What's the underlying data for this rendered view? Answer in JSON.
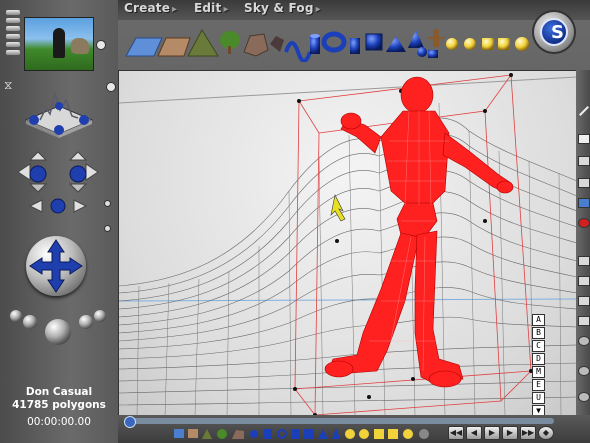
{
  "menu": {
    "items": [
      {
        "label": "Create"
      },
      {
        "label": "Edit"
      },
      {
        "label": "Sky & Fog"
      }
    ]
  },
  "status": {
    "object_name": "Don Casual",
    "polygons": "41785 polygons",
    "time": "00:00:00.00"
  },
  "viewport_labels": [
    "A",
    "B",
    "C",
    "D",
    "M",
    "E",
    "U",
    "▼"
  ],
  "toolbar": {
    "icons": [
      "water-icon",
      "terrain-icon",
      "mountain-icon",
      "tree-icon",
      "rock-icon",
      "stone-icon",
      "torus-knot-icon",
      "cylinder-icon",
      "torus-icon",
      "cylinder-icon",
      "cube-icon",
      "pyramid-icon",
      "cone-icon",
      "sphere-icon",
      "figure-icon",
      "light-icon",
      "light-icon",
      "light-icon",
      "light-icon",
      "light-icon",
      "light-icon"
    ]
  },
  "colors": {
    "accent_blue": "#1a3fb8",
    "wireframe_selected": "#ff2020",
    "wireframe_terrain": "#555555"
  }
}
